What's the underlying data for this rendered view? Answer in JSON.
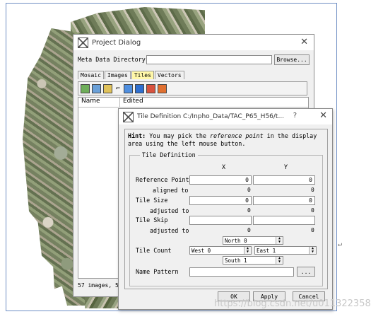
{
  "project_dialog": {
    "title": "Project Dialog",
    "meta_label": "Meta Data Directory",
    "meta_value": "",
    "browse": "Browse...",
    "tabs": [
      {
        "label": "Mosaic",
        "active": false
      },
      {
        "label": "Images",
        "active": false
      },
      {
        "label": "Tiles",
        "active": true
      },
      {
        "label": "Vectors",
        "active": false
      }
    ],
    "columns": [
      "Name",
      "Edited"
    ],
    "status": "57 images, 5"
  },
  "tile_dialog": {
    "title": "Tile Definition C:/Inpho_Data/TAC_P65_H56/t...",
    "help": "?",
    "hint_bold": "Hint:",
    "hint_1": " You may pick the ",
    "hint_em": "reference point",
    "hint_2": " in the display area using the left mouse button.",
    "group_title": "Tile Definition",
    "col_x": "X",
    "col_y": "Y",
    "reference_point": {
      "label": "Reference Point",
      "x": "0",
      "y": "0"
    },
    "aligned_to": {
      "label": "aligned to",
      "x": "0",
      "y": "0"
    },
    "tile_size": {
      "label": "Tile Size",
      "x": "0",
      "y": "0"
    },
    "adjusted_to_1": {
      "label": "adjusted to",
      "x": "0",
      "y": "0"
    },
    "tile_skip": {
      "label": "Tile Skip",
      "x": "",
      "y": ""
    },
    "adjusted_to_2": {
      "label": "adjusted to",
      "x": "0",
      "y": "0"
    },
    "tile_count": {
      "label": "Tile Count",
      "north": "North 0",
      "west": "West 0",
      "east": "East 1",
      "south": "South 1"
    },
    "name_pattern": {
      "label": "Name Pattern",
      "value": "",
      "browse": "..."
    },
    "ok": "OK",
    "apply": "Apply",
    "cancel": "Cancel"
  },
  "watermark": "https://blog.csdn.net/u011322358",
  "corner_glyph": "↵"
}
